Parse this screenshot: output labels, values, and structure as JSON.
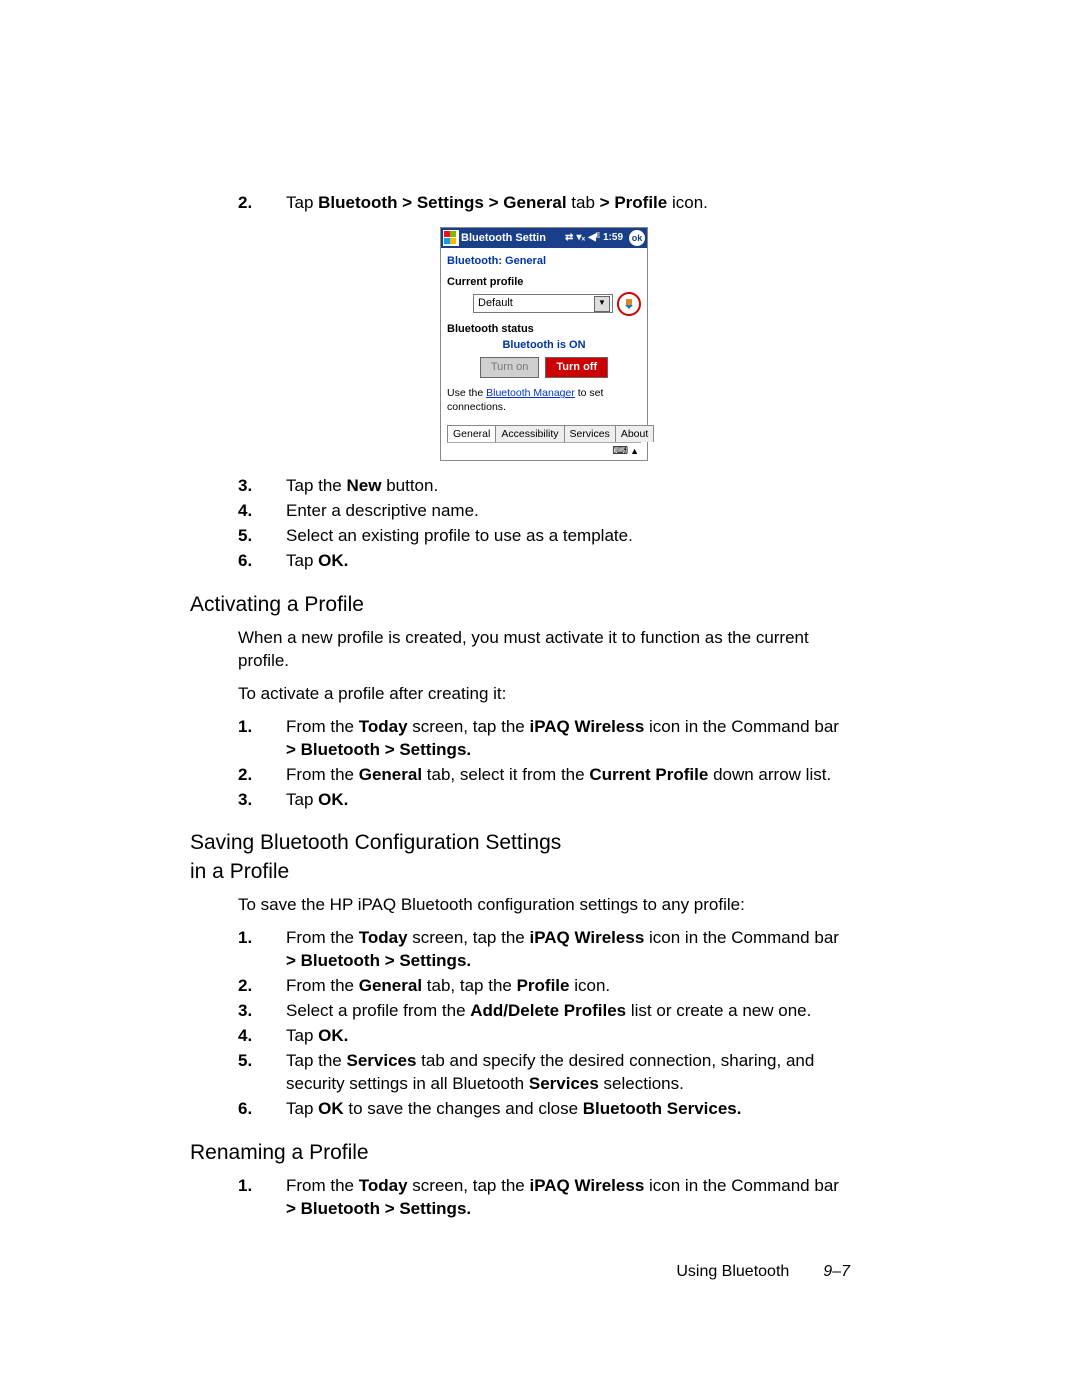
{
  "pre_steps": [
    {
      "n": "2.",
      "text_before": "Tap ",
      "bold1": "Bluetooth > Settings > General",
      "mid": " tab ",
      "bold2": "> Profile",
      "after": " icon."
    }
  ],
  "device": {
    "title": "Bluetooth Settin",
    "time": "1:59",
    "ok": "ok",
    "heading": "Bluetooth: General",
    "current_profile_label": "Current profile",
    "current_profile_value": "Default",
    "status_label": "Bluetooth status",
    "status_text": "Bluetooth is ON",
    "turn_on": "Turn on",
    "turn_off": "Turn off",
    "hint_pre": "Use the ",
    "hint_link": "Bluetooth Manager",
    "hint_post": " to set connections.",
    "tabs": [
      "General",
      "Accessibility",
      "Services",
      "About"
    ]
  },
  "post_steps": [
    {
      "n": "3.",
      "pre": "Tap the ",
      "bold": "New",
      "post": " button."
    },
    {
      "n": "4.",
      "plain": "Enter a descriptive name."
    },
    {
      "n": "5.",
      "plain": "Select an existing profile to use as a template."
    },
    {
      "n": "6.",
      "pre": "Tap ",
      "bold": "OK.",
      "post": ""
    }
  ],
  "sec_activate": {
    "title": "Activating a Profile",
    "para1": "When a new profile is created, you must activate it to function as the current profile.",
    "para2": "To activate a profile after creating it:",
    "steps": [
      {
        "n": "1.",
        "pre": "From the ",
        "b1": "Today",
        "mid": " screen, tap the ",
        "b2": "iPAQ Wireless",
        "post": " icon in the Command bar ",
        "b3": "> Bluetooth > Settings."
      },
      {
        "n": "2.",
        "pre": "From the ",
        "b1": "General",
        "mid": " tab, select it from the ",
        "b2": "Current Profile",
        "post": " down arrow list."
      },
      {
        "n": "3.",
        "pre": "Tap ",
        "b1": "OK.",
        "mid": "",
        "b2": "",
        "post": ""
      }
    ]
  },
  "sec_save": {
    "title_l1": "Saving Bluetooth Configuration Settings",
    "title_l2": "in a Profile",
    "para": "To save the HP iPAQ Bluetooth configuration settings to any profile:",
    "steps": [
      {
        "n": "1.",
        "pre": "From the ",
        "b1": "Today",
        "mid": " screen, tap the ",
        "b2": "iPAQ Wireless",
        "post": " icon in the Command bar ",
        "b3": "> Bluetooth > Settings."
      },
      {
        "n": "2.",
        "pre": "From the ",
        "b1": "General",
        "mid": " tab, tap the ",
        "b2": "Profile",
        "post": " icon."
      },
      {
        "n": "3.",
        "pre": "Select a profile from the ",
        "b1": "Add/Delete Profiles",
        "mid": " list or create a new one.",
        "b2": "",
        "post": ""
      },
      {
        "n": "4.",
        "pre": "Tap ",
        "b1": "OK.",
        "mid": "",
        "b2": "",
        "post": ""
      },
      {
        "n": "5.",
        "pre": "Tap the ",
        "b1": "Services",
        "mid": " tab and specify the desired connection, sharing, and security settings in all Bluetooth ",
        "b2": "Services",
        "post": " selections."
      },
      {
        "n": "6.",
        "pre": "Tap ",
        "b1": "OK",
        "mid": " to save the changes and close ",
        "b2": "Bluetooth Services.",
        "post": ""
      }
    ]
  },
  "sec_rename": {
    "title": "Renaming a Profile",
    "steps": [
      {
        "n": "1.",
        "pre": "From the ",
        "b1": "Today",
        "mid": " screen, tap the ",
        "b2": "iPAQ Wireless",
        "post": " icon in the Command bar ",
        "b3": "> Bluetooth > Settings."
      }
    ]
  },
  "footer": {
    "left": "Using Bluetooth",
    "right": "9–7"
  }
}
